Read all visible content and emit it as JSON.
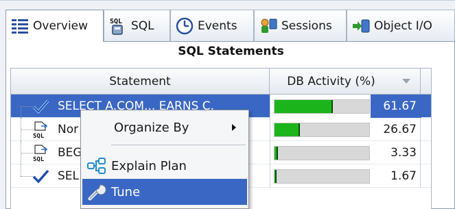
{
  "tabs": [
    {
      "label": "Overview",
      "icon": "overview-icon",
      "active": true
    },
    {
      "label": "SQL",
      "icon": "sql-icon",
      "active": false
    },
    {
      "label": "Events",
      "icon": "events-clock-icon",
      "active": false
    },
    {
      "label": "Sessions",
      "icon": "sessions-icon",
      "active": false
    },
    {
      "label": "Object I/O",
      "icon": "object-io-icon",
      "active": false
    }
  ],
  "panel": {
    "title": "SQL Statements"
  },
  "table": {
    "columns": [
      "Statement",
      "DB Activity (%)"
    ],
    "rows": [
      {
        "statement": "SELECT A.COM... EARNS C.",
        "activity_pct": 61.67,
        "activity_label": "61.67",
        "icon": "check-icon",
        "selected": true
      },
      {
        "statement": "Nor",
        "activity_pct": 26.67,
        "activity_label": "26.67",
        "icon": "sql-doc-icon",
        "selected": false
      },
      {
        "statement": "BEG",
        "activity_pct": 3.33,
        "activity_label": "3.33",
        "icon": "sql-doc-icon",
        "selected": false
      },
      {
        "statement": "SEL",
        "activity_pct": 1.67,
        "activity_label": "1.67",
        "icon": "check-icon",
        "selected": false
      }
    ]
  },
  "context_menu": {
    "items": [
      {
        "label": "Organize By",
        "icon": "",
        "has_submenu": true
      },
      {
        "label": "Explain Plan",
        "icon": "explain-plan-icon",
        "has_submenu": false
      },
      {
        "label": "Tune",
        "icon": "wrench-icon",
        "has_submenu": false,
        "highlighted": true
      }
    ]
  },
  "colors": {
    "selection": "#3a67c4",
    "bar_fill": "#1bb51b",
    "bar_track": "#d8d8d8"
  }
}
